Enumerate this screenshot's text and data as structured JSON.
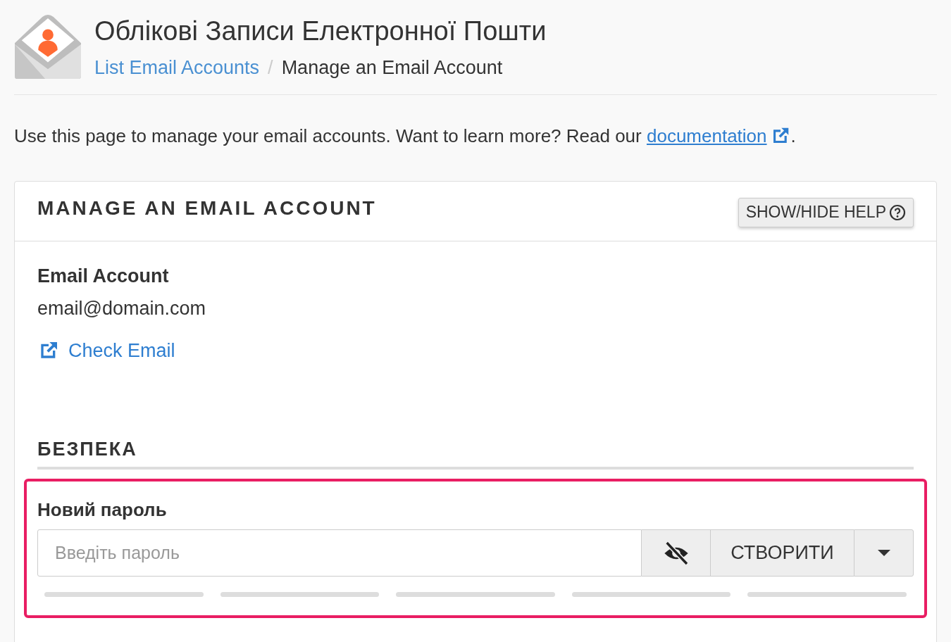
{
  "page": {
    "title": "Облікові Записи Електронної Пошти"
  },
  "breadcrumb": [
    {
      "label": "List Email Accounts",
      "kind": "link"
    },
    {
      "label": "/",
      "kind": "separator"
    },
    {
      "label": "Manage an Email Account",
      "kind": "current"
    }
  ],
  "description": {
    "text": "Use this page to manage your email accounts. Want to learn more? Read our",
    "link": "documentation",
    "end": "."
  },
  "panel": {
    "title": "MANAGE AN EMAIL ACCOUNT",
    "help_button": "SHOW/HIDE HELP",
    "account_label": "Email Account",
    "account_value": "email@domain.com",
    "check_email": "Check Email",
    "section_title": "БЕЗПЕКА",
    "password": {
      "label": "Новий пароль",
      "placeholder": "Введіть пароль",
      "highlighted": true,
      "generate_button": "СТВОРИТИ",
      "strength": {
        "level": 0
      }
    }
  }
}
